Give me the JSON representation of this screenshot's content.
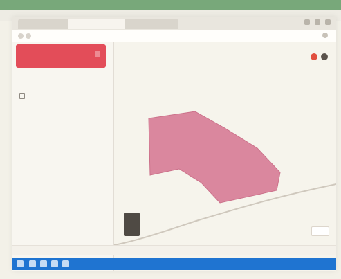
{
  "browser": {
    "tabs": [
      "",
      "",
      ""
    ],
    "url": ""
  },
  "left_panel": {
    "header": "",
    "layer_title": "",
    "layer_item": "",
    "add_layer": ""
  },
  "map": {
    "road_label_1": "",
    "road_label_2": "",
    "zoom_label": "",
    "footer_text": "",
    "colors": {
      "polygon_fill": "#d9829a",
      "polygon_stroke": "#c96a85",
      "road_color": "#cfc8bd",
      "accent_red": "#e34d59"
    }
  },
  "taskbar": {
    "time": ""
  }
}
